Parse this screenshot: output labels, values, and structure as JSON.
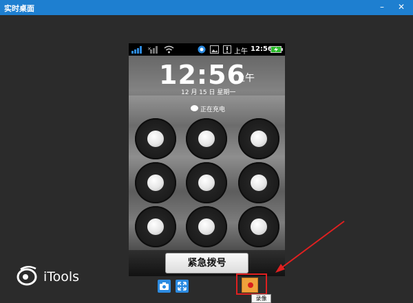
{
  "window": {
    "title": "实时桌面",
    "colors": {
      "titlebar": "#1e7fd0",
      "background": "#2b2b2b"
    }
  },
  "statusbar": {
    "ampm": "上午",
    "time": "12:56"
  },
  "lockscreen": {
    "time": "12:56",
    "ampm": "上午",
    "date": "12 月 15 日 星期一",
    "charging": "正在充电",
    "emergency_button": "紧急拨号"
  },
  "brand": {
    "name": "iTools"
  },
  "toolbar": {
    "record_tooltip": "录像"
  },
  "colors": {
    "accent_blue": "#2d8be0",
    "highlight_red": "#e02020",
    "record_orange": "#f0a23c"
  }
}
